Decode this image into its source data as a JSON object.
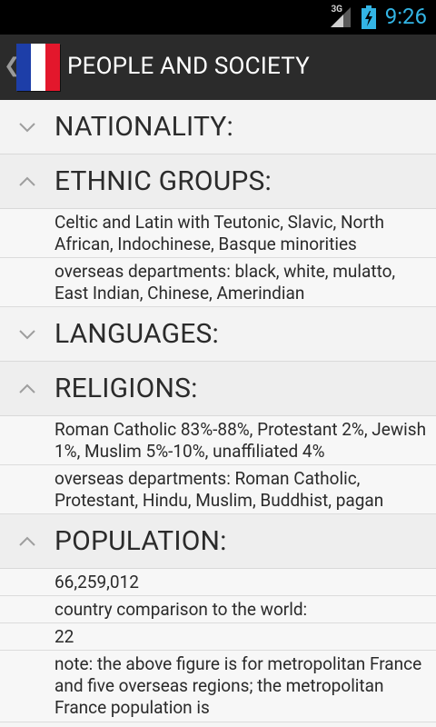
{
  "status_bar": {
    "network": "3G",
    "time": "9:26"
  },
  "action_bar": {
    "title": "PEOPLE AND SOCIETY",
    "flag_icon": "flag-france-icon",
    "flag_colors": [
      "#1d3ea8",
      "#ffffff",
      "#e3172c"
    ]
  },
  "sections": [
    {
      "title": "NATIONALITY:",
      "expanded": false,
      "items": []
    },
    {
      "title": "ETHNIC GROUPS:",
      "expanded": true,
      "items": [
        "Celtic and Latin with Teutonic, Slavic, North African, Indochinese, Basque minorities",
        "overseas departments: black, white, mulatto, East Indian, Chinese, Amerindian"
      ]
    },
    {
      "title": "LANGUAGES:",
      "expanded": false,
      "items": []
    },
    {
      "title": "RELIGIONS:",
      "expanded": true,
      "items": [
        "Roman Catholic 83%-88%, Protestant 2%, Jewish 1%, Muslim 5%-10%, unaffiliated 4%",
        "overseas departments: Roman Catholic, Protestant, Hindu, Muslim, Buddhist, pagan"
      ]
    },
    {
      "title": "POPULATION:",
      "expanded": true,
      "items": [
        "66,259,012",
        "country comparison to the world:",
        "22",
        "note: the above figure is for metropolitan France and five overseas regions; the metropolitan France population is"
      ]
    }
  ]
}
